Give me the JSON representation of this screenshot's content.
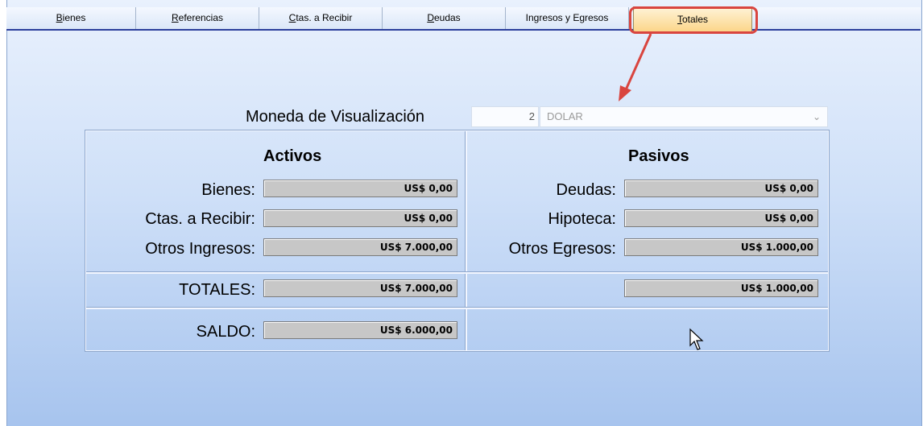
{
  "tabs": [
    {
      "label": "Bienes",
      "u": "B",
      "rest": "ienes"
    },
    {
      "label": "Referencias",
      "u": "R",
      "rest": "eferencias"
    },
    {
      "label": "Ctas. a Recibir",
      "u": "C",
      "rest": "tas. a Recibir"
    },
    {
      "label": "Deudas",
      "u": "D",
      "rest": "eudas"
    },
    {
      "label": "Ingresos y Egresos",
      "u": "",
      "rest": "Ingresos y Egresos"
    },
    {
      "label": "Totales",
      "u": "T",
      "rest": "otales"
    }
  ],
  "moneda": {
    "label": "Moneda de Visualización",
    "code": "2",
    "value": "DOLAR"
  },
  "activos": {
    "title": "Activos",
    "bienes_label": "Bienes:",
    "bienes_value": "US$ 0,00",
    "ctas_label": "Ctas. a Recibir:",
    "ctas_value": "US$ 0,00",
    "otros_label": "Otros Ingresos:",
    "otros_value": "US$ 7.000,00"
  },
  "pasivos": {
    "title": "Pasivos",
    "deudas_label": "Deudas:",
    "deudas_value": "US$ 0,00",
    "hipoteca_label": "Hipoteca:",
    "hipoteca_value": "US$ 0,00",
    "otros_label": "Otros Egresos:",
    "otros_value": "US$ 1.000,00"
  },
  "totales": {
    "label": "TOTALES:",
    "activos_value": "US$ 7.000,00",
    "pasivos_value": "US$ 1.000,00"
  },
  "saldo": {
    "label": "SALDO:",
    "value": "US$ 6.000,00"
  },
  "colors": {
    "highlight": "#d9453f",
    "tab_active": "#fbd68a",
    "tab_line": "#2c3f9c"
  }
}
